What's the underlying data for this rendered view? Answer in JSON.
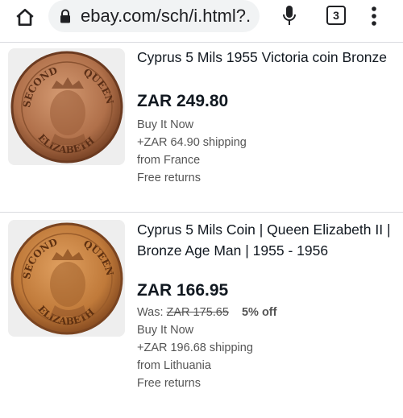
{
  "browser": {
    "url": "ebay.com/sch/i.html?.",
    "tab_count": "3"
  },
  "listings": [
    {
      "title_lines": [
        "Cyprus 5 Mils 1955 Victoria coin Bronze"
      ],
      "price": "ZAR 249.80",
      "format": "Buy It Now",
      "shipping": "+ZAR 64.90 shipping",
      "location": "from France",
      "returns": "Free returns",
      "image": {
        "legend_top": "QUEEN",
        "legend_left": "SECOND",
        "legend_bottom": "ELIZABETH",
        "color": "#b0704a"
      }
    },
    {
      "title_lines": [
        "Cyprus 5 Mils Coin | Queen Elizabeth II |",
        "Bronze Age Man | 1955 - 1956"
      ],
      "price": "ZAR 166.95",
      "was_label": "Was:",
      "was_price": "ZAR 175.65",
      "discount": "5% off",
      "format": "Buy It Now",
      "shipping": "+ZAR 196.68 shipping",
      "location": "from Lithuania",
      "returns": "Free returns",
      "image": {
        "legend_top": "QUEEN",
        "legend_left": "SECOND",
        "legend_bottom": "ELIZABETH",
        "color": "#c07a3a"
      }
    }
  ],
  "colors": {
    "url_pill": "#f1f3f4",
    "text_primary": "#111820",
    "text_secondary": "#555555",
    "thumb_bg": "#eeeeee"
  },
  "icons": [
    "home-icon",
    "lock-icon",
    "mic-icon",
    "more-vert-icon"
  ]
}
